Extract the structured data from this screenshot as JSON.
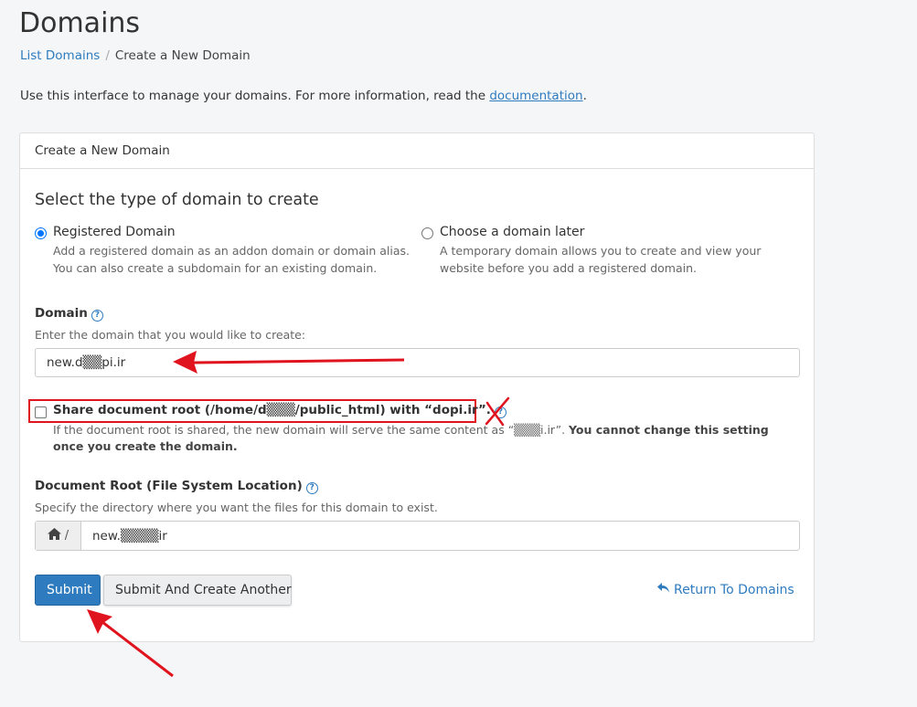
{
  "page": {
    "title": "Domains",
    "breadcrumb": {
      "parent": "List Domains",
      "separator": "/",
      "current": "Create a New Domain"
    },
    "intro_text": "Use this interface to manage your domains. For more information, read the ",
    "intro_link": "documentation",
    "intro_end": "."
  },
  "panel": {
    "heading": "Create a New Domain",
    "section_title": "Select the type of domain to create",
    "options": [
      {
        "label": "Registered Domain",
        "checked": true,
        "description": "Add a registered domain as an addon domain or domain alias. You can also create a subdomain for an existing domain."
      },
      {
        "label": "Choose a domain later",
        "checked": false,
        "description": "A temporary domain allows you to create and view your website before you add a registered domain."
      }
    ],
    "domain": {
      "label": "Domain",
      "hint": "Enter the domain that you would like to create:",
      "value": "new.d▒▒pi.ir"
    },
    "share_root": {
      "label": "Share document root (/home/d▒▒▒/public_html) with “dopi.ir”.",
      "checked": false,
      "description": "If the document root is shared, the new domain will serve the same content as “▒▒▒i.ir”.",
      "warning": "You cannot change this setting once you create the domain."
    },
    "document_root": {
      "label": "Document Root (File System Location)",
      "hint": "Specify the directory where you want the files for this domain to exist.",
      "prefix": "/",
      "value": "new.▒▒▒▒ir"
    },
    "buttons": {
      "submit": "Submit",
      "submit_another": "Submit And Create Another",
      "return": "Return To Domains"
    }
  },
  "colors": {
    "link": "#2e7bbf",
    "primary": "#2e7bbf",
    "annotation_red": "#e0141e"
  },
  "icons": {
    "help": "question-circle-icon",
    "home": "home-icon",
    "return": "undo-arrow-icon"
  }
}
